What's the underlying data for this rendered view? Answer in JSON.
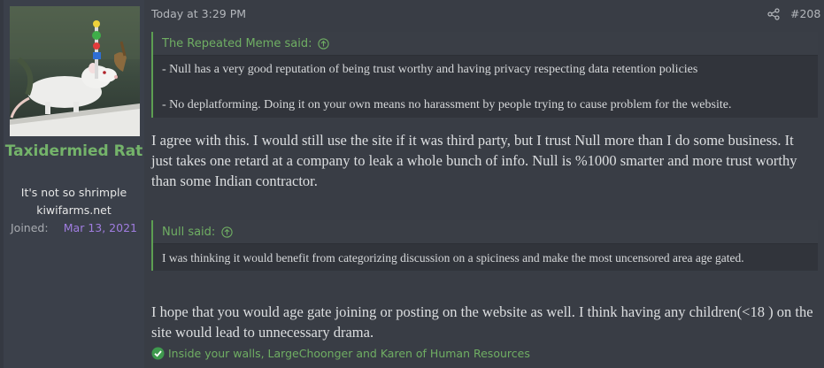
{
  "user": {
    "name": "Taxidermied Rat",
    "title": "It's not so shrimple",
    "subtitle": "kiwifarms.net",
    "joined_label": "Joined:",
    "joined_date": "Mar 13, 2021"
  },
  "post": {
    "timestamp": "Today at 3:29 PM",
    "number": "#208",
    "quote1": {
      "author": "The Repeated Meme said:",
      "lines": [
        "- Null has a very good reputation of being trust worthy and having privacy respecting data retention policies",
        "- No deplatforming. Doing it on your own means no harassment by people trying to cause problem for the website."
      ]
    },
    "reply1": "I agree with this. I would still use the site if it was third party, but I trust Null more than I do some business. It just takes one retard at a company to leak a whole bunch of info. Null is %1000 smarter and more trust worthy than some Indian contractor.",
    "quote2": {
      "author": "Null said:",
      "text": "I was thinking it would benefit from categorizing discussion on a spiciness and make the most uncensored area age gated."
    },
    "reply2": "I hope that you would age gate joining or posting on the website as well. I think having any children(<18 ) on the site would lead to unnecessary drama.",
    "reactions": "Inside your walls, LargeChoonger and Karen of Human Resources"
  },
  "colors": {
    "accent_green": "#6fae63",
    "joined_purple": "#a07de0",
    "background": "#393d45"
  },
  "icons": {
    "share": "share-icon",
    "quote_jump": "arrow-up-circle-icon",
    "reaction": "check-circle-icon"
  }
}
